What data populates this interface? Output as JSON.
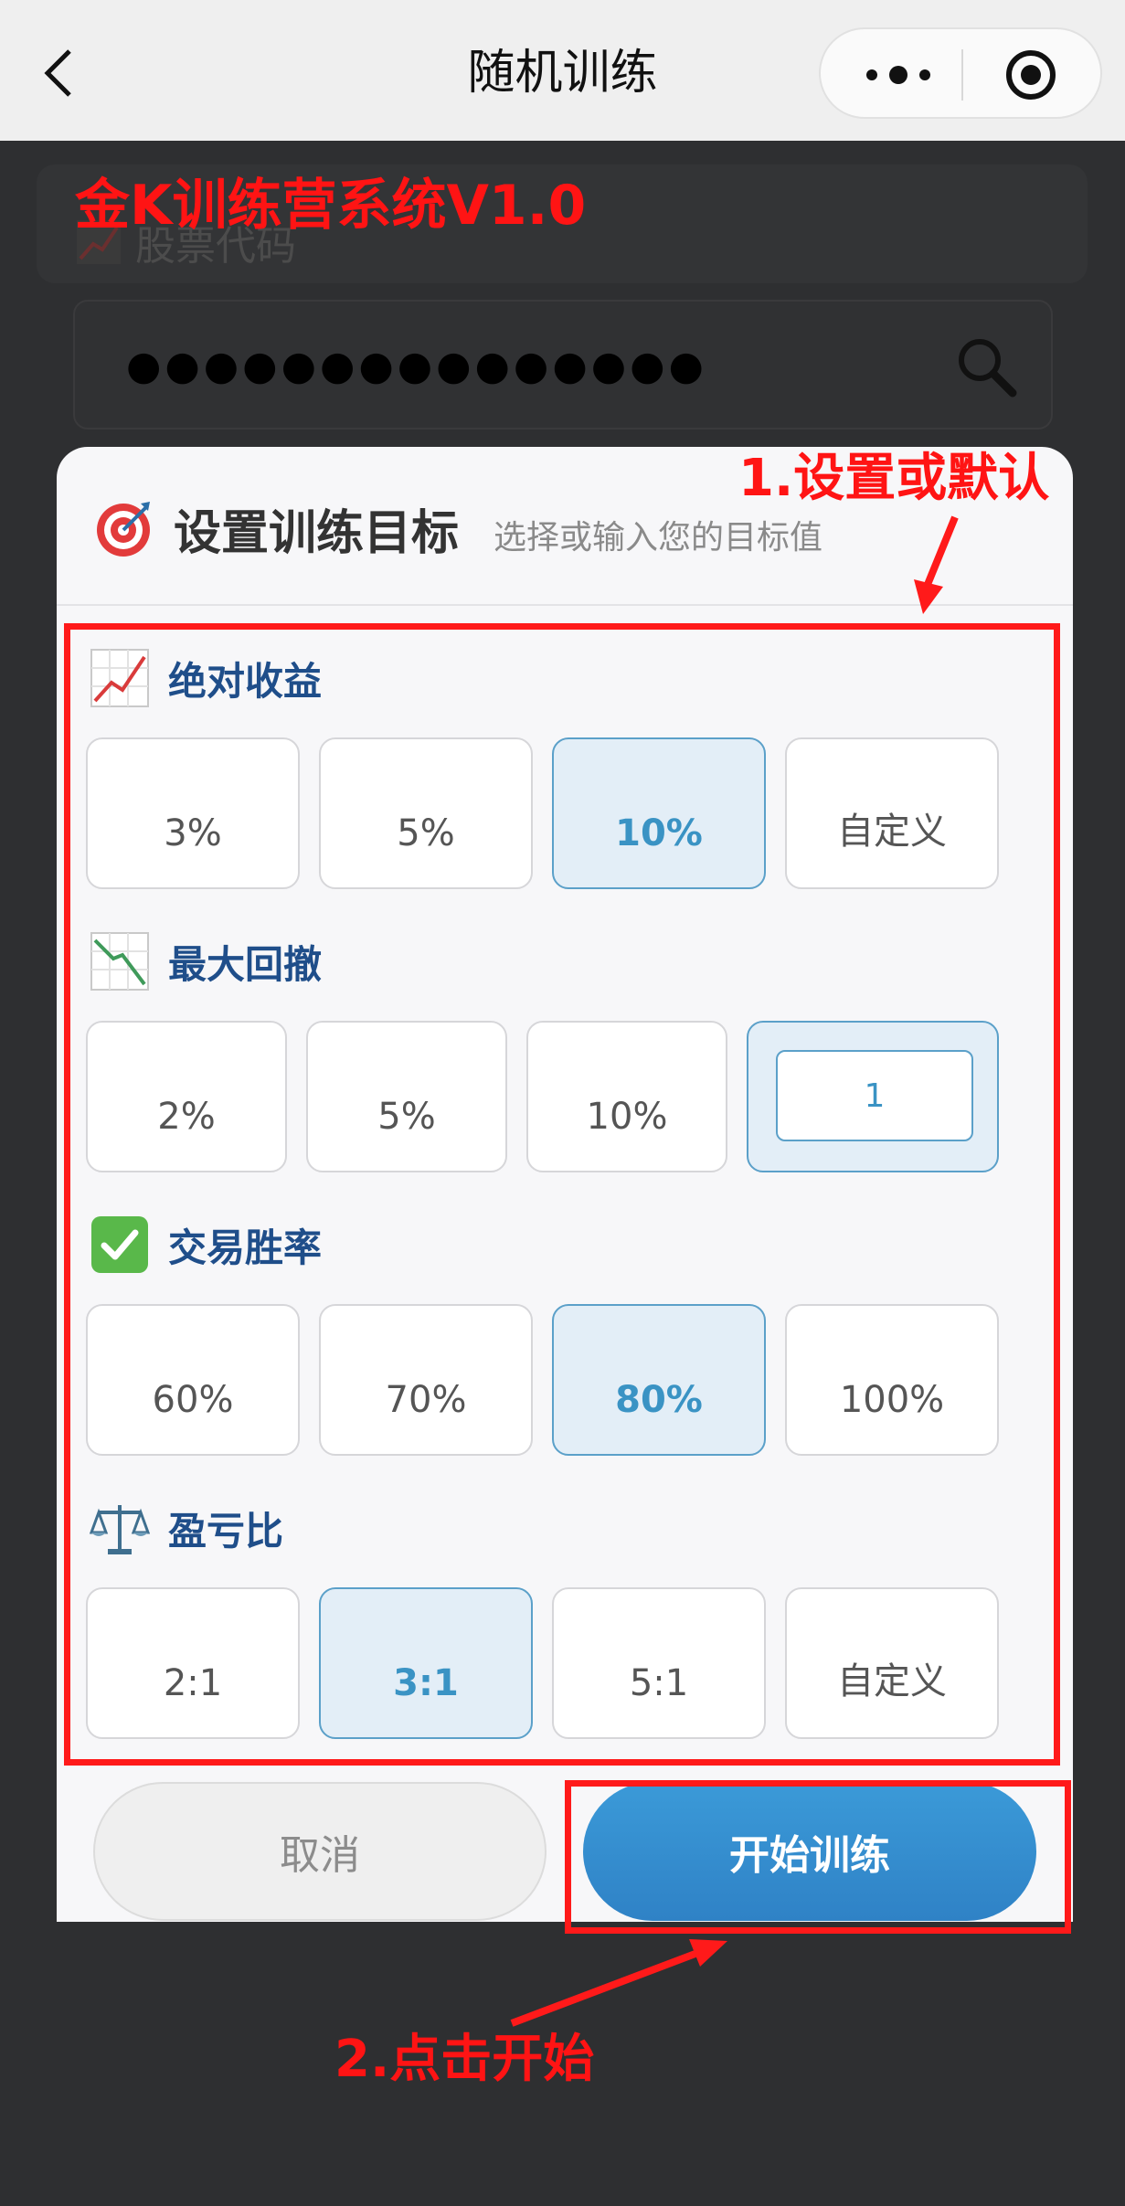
{
  "navbar": {
    "title": "随机训练",
    "icons": {
      "back": "chevron-left-icon",
      "more": "more-dots-icon",
      "close": "target-circle-icon"
    }
  },
  "background": {
    "stock_label": "股票代码",
    "stock_value": "●●●●●●●●●●●●●●●",
    "icons": {
      "chart": "line-chart-icon",
      "search": "magnifier-icon"
    }
  },
  "annotations": {
    "title": "金K训练营系统V1.0",
    "step1": "1.设置或默认",
    "step2": "2.点击开始",
    "color": "#ff1414"
  },
  "modal": {
    "title": "设置训练目标",
    "subtitle": "选择或输入您的目标值",
    "header_icon": "dart-target-icon",
    "sections": [
      {
        "label": "绝对收益",
        "icon": "chart-increasing-icon",
        "options": [
          "3%",
          "5%",
          "10%",
          "自定义"
        ],
        "selected": "10%"
      },
      {
        "label": "最大回撤",
        "icon": "chart-decreasing-icon",
        "options": [
          "2%",
          "5%",
          "10%"
        ],
        "custom_value": "1",
        "selected": "custom"
      },
      {
        "label": "交易胜率",
        "icon": "check-mark-button-icon",
        "options": [
          "60%",
          "70%",
          "80%",
          "100%"
        ],
        "selected": "80%"
      },
      {
        "label": "盈亏比",
        "icon": "balance-scale-icon",
        "options": [
          "2:1",
          "3:1",
          "5:1",
          "自定义"
        ],
        "selected": "3:1"
      }
    ],
    "cancel_label": "取消",
    "start_label": "开始训练"
  },
  "colors": {
    "accent": "#3a93c4",
    "section_label": "#1f4e8a",
    "selected_bg": "#e3eef7",
    "start_button": "#2f82c6"
  }
}
